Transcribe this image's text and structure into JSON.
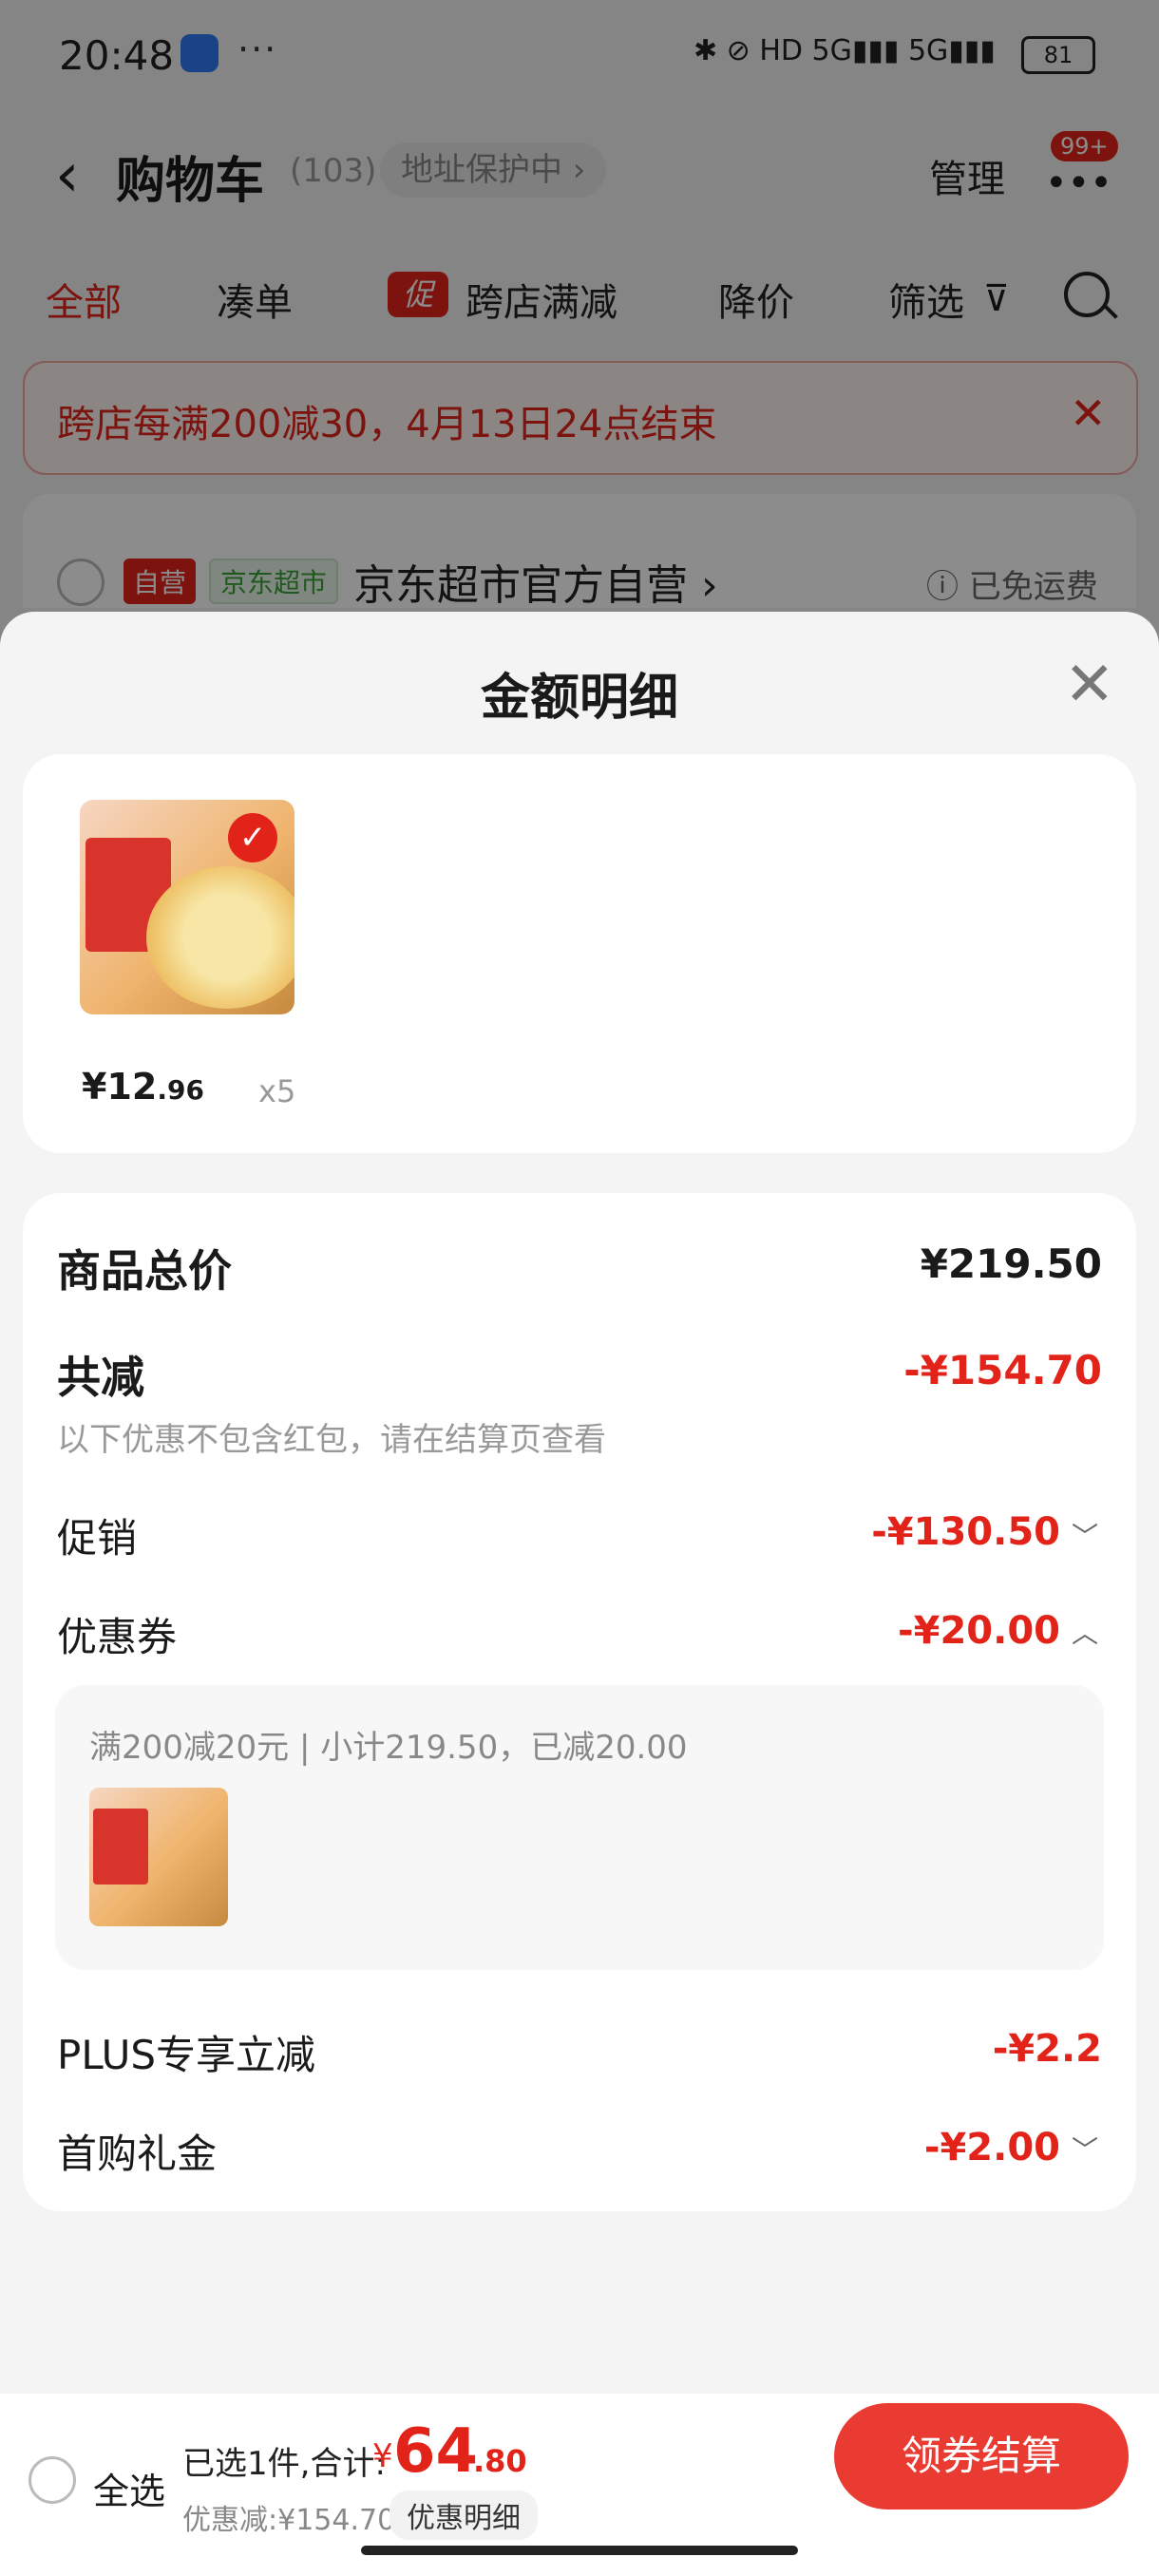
{
  "status_bar": {
    "time": "20:48",
    "dots": "···",
    "icons": "✱  ⊘  HD  5G▮▮▮  5G▮▮▮",
    "battery": "81"
  },
  "header": {
    "back": "‹",
    "title": "购物车",
    "count": "(103)",
    "address": "地址保护中 ›",
    "manage": "管理",
    "more": "•••",
    "badge": "99+"
  },
  "tabs": [
    {
      "label": "全部",
      "active": true
    },
    {
      "label": "凑单"
    },
    {
      "label": "跨店满减",
      "tag": "促"
    },
    {
      "label": "降价"
    },
    {
      "label": "筛选"
    }
  ],
  "banner": {
    "text": "跨店每满200减30，4月13日24点结束",
    "close": "✕"
  },
  "store": {
    "self_tag": "自营",
    "mart_tag": "京东超市",
    "name": "京东超市官方自营 ›",
    "shipping": "ⓘ 已免运费"
  },
  "sheet": {
    "title": "金额明细",
    "close": "✕",
    "item": {
      "price_int": "¥12",
      "price_dec": ".96",
      "qty": "x5",
      "check": "✓"
    },
    "rows": {
      "total_label": "商品总价",
      "total_value": "¥219.50",
      "reduce_label": "共减",
      "reduce_value": "-¥154.70",
      "reduce_note": "以下优惠不包含红包，请在结算页查看",
      "promo_label": "促销",
      "promo_value": "-¥130.50",
      "coupon_label": "优惠券",
      "coupon_value": "-¥20.00",
      "coupon_detail": "满200减20元 | 小计219.50，已减20.00",
      "plus_label": "PLUS专享立减",
      "plus_value": "-¥2.2",
      "first_label": "首购礼金",
      "first_value": "-¥2.00"
    },
    "chevrons": {
      "down": "﹀",
      "up": "︿"
    }
  },
  "bottom_bar": {
    "select_all": "全选",
    "selected_info": "已选1件,合计:",
    "yen": "¥",
    "total_int": "64",
    "total_dec": ".80",
    "discount": "优惠减:¥154.70",
    "detail_button": "优惠明细",
    "checkout": "领券结算"
  },
  "colors": {
    "accent": "#e2231a",
    "checkout": "#ea3b33"
  }
}
